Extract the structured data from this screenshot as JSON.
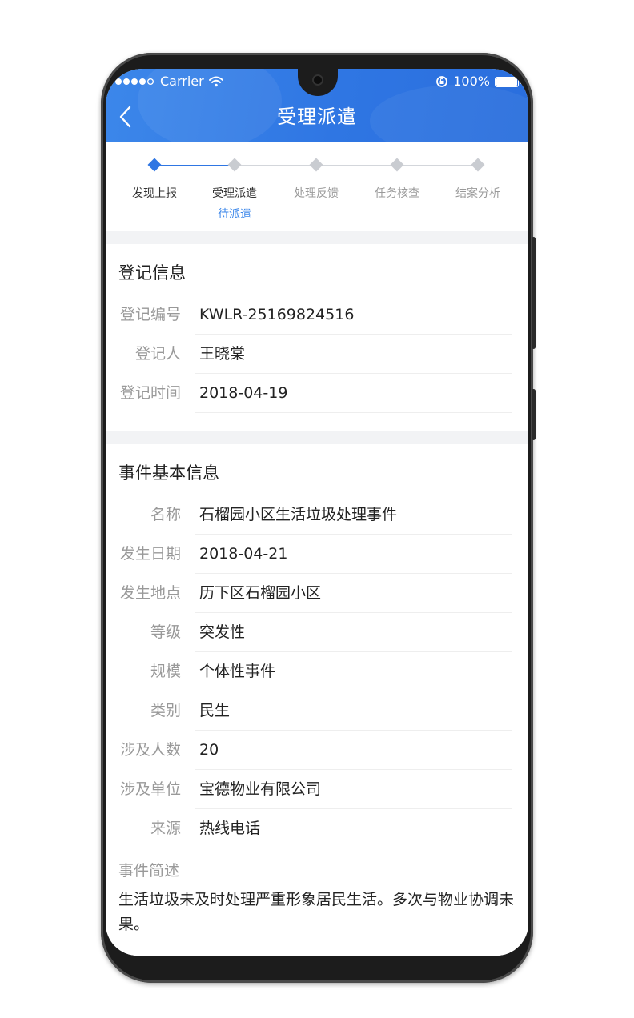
{
  "status_bar": {
    "carrier": "Carrier",
    "battery": "100%"
  },
  "header": {
    "title": "受理派遣"
  },
  "steps": [
    {
      "label": "发现上报",
      "state": "done",
      "sub": ""
    },
    {
      "label": "受理派遣",
      "state": "current",
      "sub": "待派遣"
    },
    {
      "label": "处理反馈",
      "state": "pending",
      "sub": ""
    },
    {
      "label": "任务核查",
      "state": "pending",
      "sub": ""
    },
    {
      "label": "结案分析",
      "state": "pending",
      "sub": ""
    }
  ],
  "registration": {
    "title": "登记信息",
    "fields": [
      {
        "label": "登记编号",
        "value": "KWLR-25169824516"
      },
      {
        "label": "登记人",
        "value": "王晓棠"
      },
      {
        "label": "登记时间",
        "value": "2018-04-19"
      }
    ]
  },
  "event": {
    "title": "事件基本信息",
    "fields": [
      {
        "label": "名称",
        "value": "石榴园小区生活垃圾处理事件"
      },
      {
        "label": "发生日期",
        "value": "2018-04-21"
      },
      {
        "label": "发生地点",
        "value": "历下区石榴园小区"
      },
      {
        "label": "等级",
        "value": "突发性"
      },
      {
        "label": "规模",
        "value": "个体性事件"
      },
      {
        "label": "类别",
        "value": "民生"
      },
      {
        "label": "涉及人数",
        "value": "20"
      },
      {
        "label": "涉及单位",
        "value": "宝德物业有限公司"
      },
      {
        "label": "来源",
        "value": "热线电话"
      }
    ],
    "description_label": "事件简述",
    "description": "生活垃圾未及时处理严重形象居民生活。多次与物业协调未果。"
  },
  "colors": {
    "primary": "#2f76e3",
    "accent_text": "#3c87ea"
  }
}
